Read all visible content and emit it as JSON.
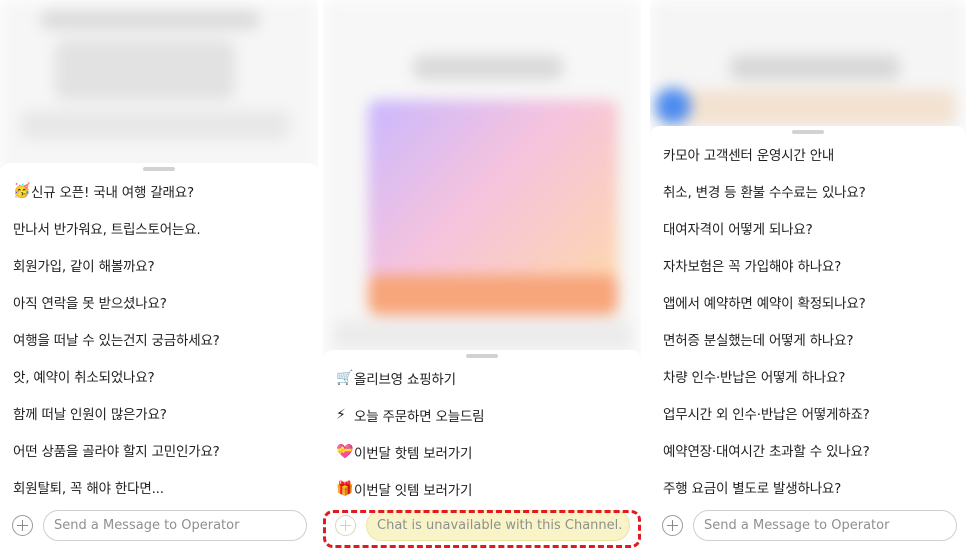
{
  "panels": [
    {
      "items": [
        {
          "emoji": "🥳",
          "label": "신규 오픈! 국내 여행 갈래요?"
        },
        {
          "emoji": "",
          "label": "만나서 반가워요, 트립스토어는요."
        },
        {
          "emoji": "",
          "label": "회원가입, 같이 해볼까요?"
        },
        {
          "emoji": "",
          "label": "아직 연락을 못 받으셨나요?"
        },
        {
          "emoji": "",
          "label": "여행을 떠날 수 있는건지 궁금하세요?"
        },
        {
          "emoji": "",
          "label": "앗, 예약이 취소되었나요?"
        },
        {
          "emoji": "",
          "label": "함께 떠날 인원이 많은가요?"
        },
        {
          "emoji": "",
          "label": "어떤 상품을 골라야 할지 고민인가요?"
        },
        {
          "emoji": "",
          "label": "회원탈퇴, 꼭 해야 한다면..."
        }
      ],
      "input": {
        "placeholder": "Send a Message to Operator",
        "disabled": false
      }
    },
    {
      "items": [
        {
          "emoji": "🛒",
          "label": "올리브영 쇼핑하기"
        },
        {
          "emoji": "⚡",
          "label": "오늘 주문하면 오늘드림"
        },
        {
          "emoji": "💝",
          "label": "이번달 핫템 보러가기"
        },
        {
          "emoji": "🎁",
          "label": "이번달 잇템 보러가기"
        }
      ],
      "input": {
        "placeholder": "Chat is unavailable with this Channel.",
        "disabled": true
      }
    },
    {
      "items": [
        {
          "emoji": "",
          "label": "카모아 고객센터 운영시간 안내"
        },
        {
          "emoji": "",
          "label": "취소, 변경 등 환불 수수료는 있나요?"
        },
        {
          "emoji": "",
          "label": "대여자격이 어떻게 되나요?"
        },
        {
          "emoji": "",
          "label": "자차보험은 꼭 가입해야 하나요?"
        },
        {
          "emoji": "",
          "label": "앱에서 예약하면 예약이 확정되나요?"
        },
        {
          "emoji": "",
          "label": "면허증 분실했는데 어떻게 하나요?"
        },
        {
          "emoji": "",
          "label": "차량 인수·반납은 어떻게 하나요?"
        },
        {
          "emoji": "",
          "label": "업무시간 외 인수·반납은 어떻게하죠?"
        },
        {
          "emoji": "",
          "label": "예약연장·대여시간 초과할 수 있나요?"
        },
        {
          "emoji": "",
          "label": "주행 요금이 별도로 발생하나요?"
        }
      ],
      "input": {
        "placeholder": "Send a Message to Operator",
        "disabled": false
      }
    }
  ],
  "colors": {
    "highlight": "#e3191f",
    "disabled_input_bg": "#f8f4c8"
  }
}
